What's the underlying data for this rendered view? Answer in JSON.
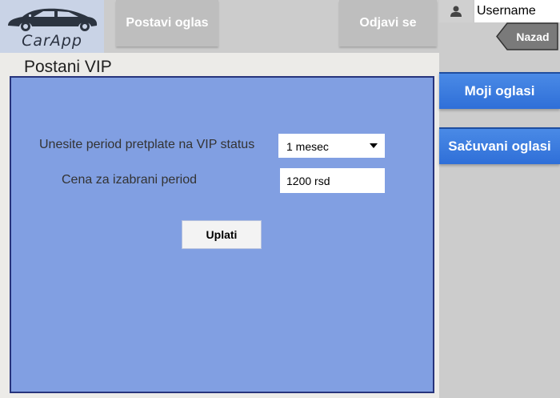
{
  "header": {
    "logo_text": "CarApp",
    "post_ad_label": "Postavi oglas",
    "logout_label": "Odjavi se",
    "username": "Username",
    "back_label": "Nazad"
  },
  "sidebar": {
    "items": [
      {
        "label": "Moji oglasi"
      },
      {
        "label": "Sačuvani oglasi"
      }
    ]
  },
  "main": {
    "title": "Postani VIP",
    "period_label": "Unesite period pretplate na VIP status",
    "period_selected": "1 mesec",
    "price_label": "Cena za izabrani period",
    "price_value": "1200 rsd",
    "pay_label": "Uplati"
  },
  "icons": {
    "logo": "car-icon",
    "user": "user-icon",
    "dropdown": "caret-down-icon",
    "back": "arrow-left-tag"
  },
  "colors": {
    "panel_bg": "#819fe2",
    "panel_border": "#27347c",
    "sidebar_button": "#3a7ee0",
    "top_button": "#bebebe",
    "back_button": "#7a7a7a"
  }
}
